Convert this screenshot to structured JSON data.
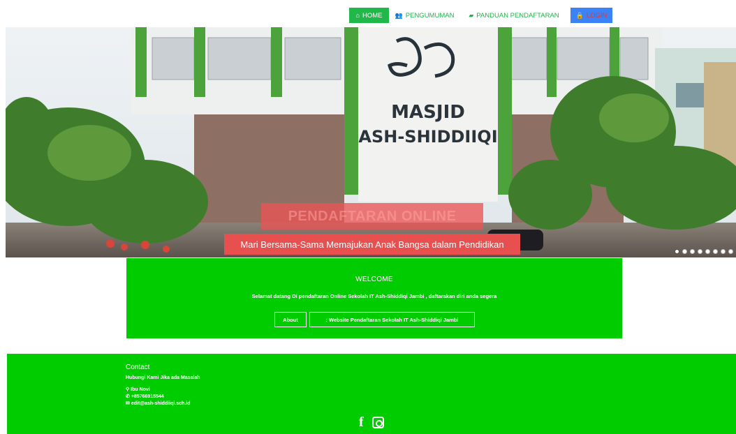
{
  "nav": {
    "items": [
      {
        "label": "HOME",
        "icon": "home-icon"
      },
      {
        "label": "PENGUMUMAN",
        "icon": "users-icon"
      },
      {
        "label": "PANDUAN PENDAFTARAN",
        "icon": "book-icon"
      },
      {
        "label": "LOGIN",
        "icon": "lock-icon"
      }
    ]
  },
  "hero": {
    "building_line1": "MASJID",
    "building_line2": "ASH-SHIDDIIQI",
    "title": "PENDAFTARAN ONLINE",
    "subtitle": "Mari Bersama-Sama Memajukan Anak Bangsa dalam Pendidikan",
    "slide_count": 8,
    "active_slide": 1
  },
  "welcome": {
    "title": "WELCOME",
    "text": "Selamat datang Di pendaftaran Online Sekolah IT Ash-Shiddiqi Jambi , daftarakan diri anda segera",
    "about_label": "About",
    "site_label": ": Website Pendaftaran Sekolah IT Ash-Shiddiqi Jambi"
  },
  "footer": {
    "contact": "Contact",
    "help": "Hubungi Kami Jika ada Masalah",
    "name": "Ibu Novi",
    "phone": "+85766915544",
    "email": "edit@ash-shiddiiqi.sch.id"
  },
  "colors": {
    "green": "#00cc00",
    "nav_green": "#21b84a",
    "login_blue": "#3b82f6",
    "banner_red": "#e8504f"
  }
}
